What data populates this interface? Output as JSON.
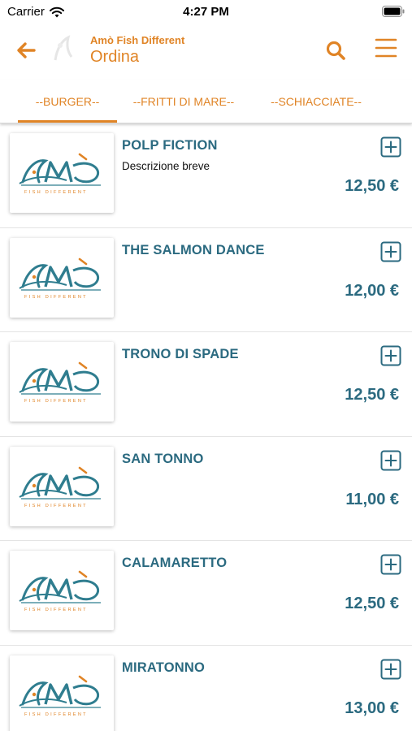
{
  "status_bar": {
    "carrier": "Carrier",
    "time": "4:27 PM"
  },
  "header": {
    "app_name": "Amò Fish Different",
    "title": "Ordina"
  },
  "tabs": [
    {
      "label": "--BURGER--",
      "active": true
    },
    {
      "label": "--FRITTI DI MARE--",
      "active": false
    },
    {
      "label": "--SCHIACCIATE--",
      "active": false
    }
  ],
  "logo": {
    "wordmark": "AMÒ",
    "tagline": "FISH DIFFERENT"
  },
  "items": [
    {
      "name": "POLP FICTION",
      "description": "Descrizione breve",
      "price": "12,50 €"
    },
    {
      "name": "THE SALMON DANCE",
      "description": "",
      "price": "12,00 €"
    },
    {
      "name": "TRONO DI SPADE",
      "description": "",
      "price": "12,50 €"
    },
    {
      "name": "SAN TONNO",
      "description": "",
      "price": "11,00 €"
    },
    {
      "name": "CALAMARETTO",
      "description": "",
      "price": "12,50 €"
    },
    {
      "name": "MIRATONNO",
      "description": "",
      "price": "13,00 €"
    }
  ],
  "colors": {
    "accent": "#e08426",
    "teal": "#2b6a80",
    "logo_teal": "#2f7d8f"
  },
  "icons": {
    "back": "arrow-left-icon",
    "search": "search-icon",
    "menu": "hamburger-menu-icon",
    "add": "plus-square-icon"
  }
}
